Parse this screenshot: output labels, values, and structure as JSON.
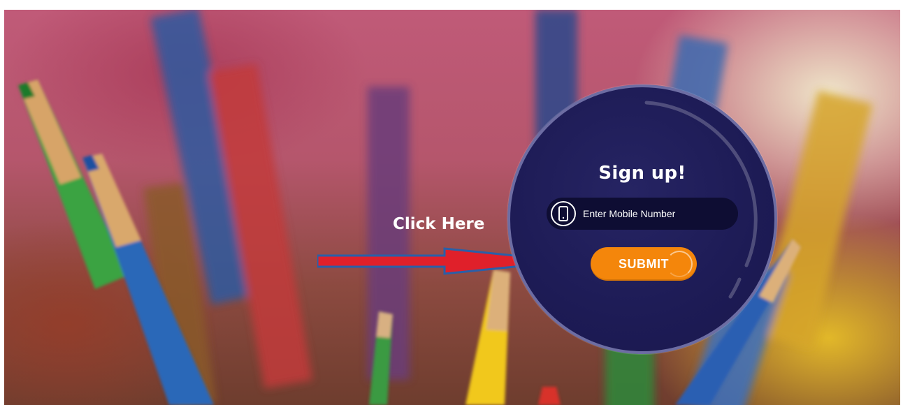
{
  "hero": {
    "annotation": "Click Here"
  },
  "signup": {
    "title": "Sign up!",
    "mobile_placeholder": "Enter Mobile Number",
    "submit_label": "SUBMIT"
  },
  "icons": {
    "phone": "phone-icon",
    "arrow": "arrow-right-icon"
  },
  "colors": {
    "panel": "#1d1b55",
    "submit": "#f4860b",
    "field": "#0e0d33",
    "arrow_fill": "#e0202a",
    "arrow_outline": "#2a5fa8"
  }
}
